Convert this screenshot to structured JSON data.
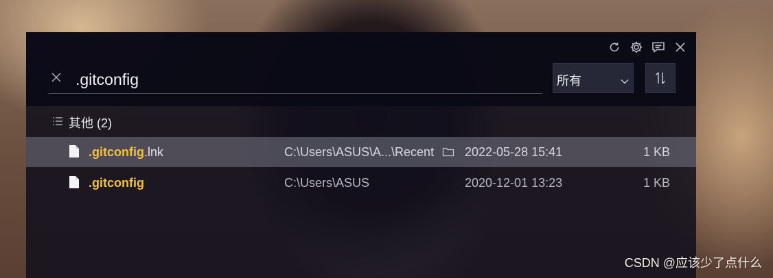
{
  "search": {
    "value": ".gitconfig"
  },
  "filter": {
    "selected": "所有"
  },
  "group": {
    "label": "其他 (2)"
  },
  "results": [
    {
      "name_highlight": ".gitconfig",
      "name_rest": ".lnk",
      "path": "C:\\Users\\ASUS\\A...\\Recent",
      "date": "2022-05-28 15:41",
      "size": "1 KB",
      "selected": true
    },
    {
      "name_highlight": ".gitconfig",
      "name_rest": "",
      "path": "C:\\Users\\ASUS",
      "date": "2020-12-01 13:23",
      "size": "1 KB",
      "selected": false
    }
  ],
  "watermark": "CSDN @应该少了点什么",
  "icons": {
    "refresh": "refresh-icon",
    "settings": "gear-icon",
    "feedback": "message-icon",
    "close": "close-icon",
    "clear": "clear-icon",
    "sort": "sort-icon",
    "list": "list-icon",
    "file": "file-icon",
    "folder": "folder-icon"
  },
  "colors": {
    "highlight": "#f2c23c",
    "panel": "#100f1c",
    "selected_row": "#787887"
  }
}
